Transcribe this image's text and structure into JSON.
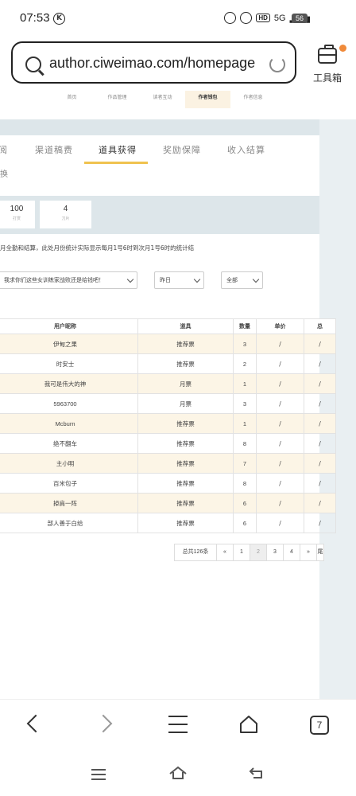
{
  "status": {
    "time": "07:53",
    "k_icon": "K",
    "hd": "HD",
    "net": "5G",
    "battery": "56"
  },
  "browser": {
    "url": "author.ciweimao.com/homepage",
    "toolbox_label": "工具箱",
    "tab_count": "7"
  },
  "topnav": [
    "首页",
    "作品管理",
    "读者互动",
    "作者钱包",
    "作者信息"
  ],
  "tabs": [
    "阅",
    "渠道稿费",
    "道具获得",
    "奖励保障",
    "收入结算"
  ],
  "tab_second_row": "换",
  "stats": [
    {
      "value": "100",
      "label": "打赏"
    },
    {
      "value": "4",
      "label": "刀片"
    }
  ],
  "notice": "月全勤和结算，此处月份统计实际显示每月1号6时到次月1号6时的统计结",
  "filters": {
    "book": "我求你们这些女训练家战败还是给钱吧！",
    "date": "昨日",
    "type": "全部"
  },
  "table": {
    "headers": [
      "用户昵称",
      "道具",
      "数量",
      "单价",
      "总"
    ],
    "rows": [
      [
        "伊甸之果",
        "推荐票",
        "3",
        "/",
        "/"
      ],
      [
        "时安士",
        "推荐票",
        "2",
        "/",
        "/"
      ],
      [
        "我可是伟大的神",
        "月票",
        "1",
        "/",
        "/"
      ],
      [
        "5963700",
        "月票",
        "3",
        "/",
        "/"
      ],
      [
        "Mcburn",
        "推荐票",
        "1",
        "/",
        "/"
      ],
      [
        "绝不翻车",
        "推荐票",
        "8",
        "/",
        "/"
      ],
      [
        "主小明",
        "推荐票",
        "7",
        "/",
        "/"
      ],
      [
        "百米包子",
        "推荐票",
        "8",
        "/",
        "/"
      ],
      [
        "掉肩一阵",
        "推荐票",
        "6",
        "/",
        "/"
      ],
      [
        "部人善于白给",
        "推荐票",
        "6",
        "/",
        "/"
      ]
    ]
  },
  "pager": {
    "total": "总共126条",
    "prev": "«",
    "pages": [
      "1",
      "2",
      "3",
      "4"
    ],
    "current": "2",
    "next": "»",
    "tail": "尾"
  },
  "icons": [
    "search-icon",
    "reload-icon",
    "toolbox-icon",
    "back-icon",
    "forward-icon",
    "menu-icon",
    "home-icon",
    "tabs-icon"
  ]
}
